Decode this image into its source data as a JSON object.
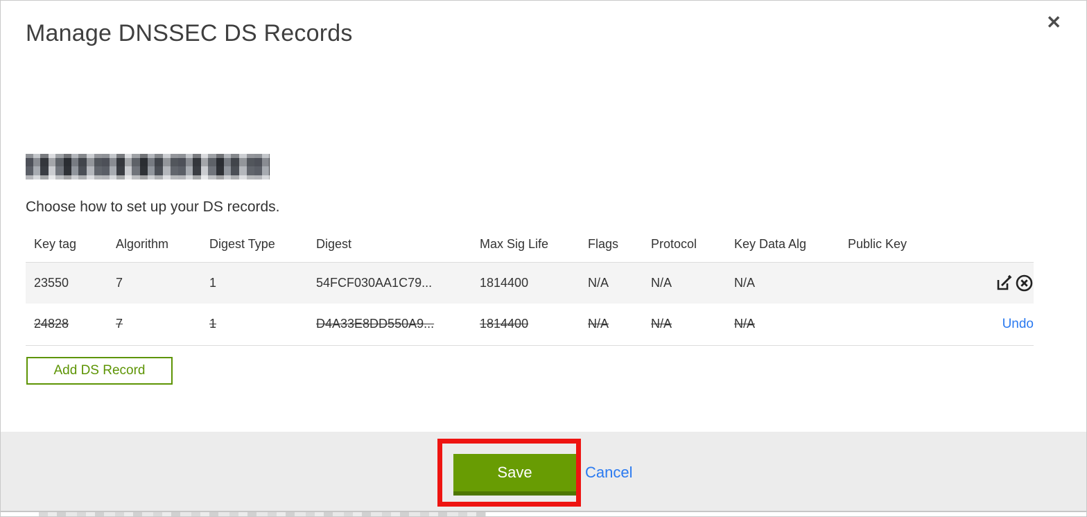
{
  "modal": {
    "title": "Manage DNSSEC DS Records",
    "close_glyph": "✕",
    "subtitle": "Choose how to set up your DS records.",
    "table": {
      "headers": [
        "Key tag",
        "Algorithm",
        "Digest Type",
        "Digest",
        "Max Sig Life",
        "Flags",
        "Protocol",
        "Key Data Alg",
        "Public Key"
      ],
      "rows": [
        {
          "key_tag": "23550",
          "algorithm": "7",
          "digest_type": "1",
          "digest": "54FCF030AA1C79...",
          "max_sig_life": "1814400",
          "flags": "N/A",
          "protocol": "N/A",
          "key_data_alg": "N/A",
          "public_key": "",
          "state": "active"
        },
        {
          "key_tag": "24828",
          "algorithm": "7",
          "digest_type": "1",
          "digest": "D4A33E8DD550A9...",
          "max_sig_life": "1814400",
          "flags": "N/A",
          "protocol": "N/A",
          "key_data_alg": "N/A",
          "public_key": "",
          "state": "deleted",
          "undo_label": "Undo"
        }
      ]
    },
    "add_button_label": "Add DS Record",
    "footer": {
      "save_label": "Save",
      "cancel_label": "Cancel"
    }
  },
  "colors": {
    "accent_green": "#689c03",
    "accent_green_dark": "#4e7701",
    "outline_green": "#5d9404",
    "link_blue": "#2b7af0",
    "annotation_red": "#ee1411",
    "row_gray": "#f4f4f4",
    "footer_gray": "#ececec",
    "text_dark": "#333333"
  }
}
